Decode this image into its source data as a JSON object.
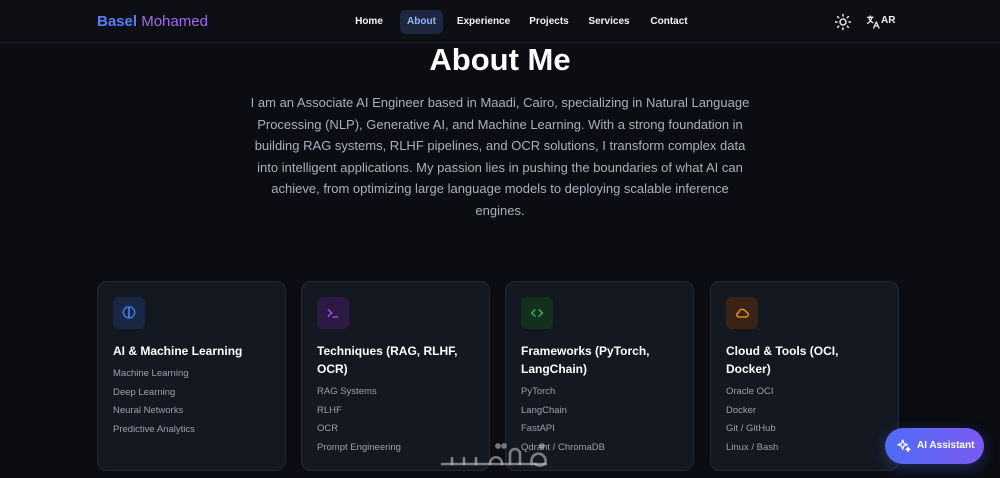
{
  "nav": {
    "brand_first": "Basel",
    "brand_last": "Mohamed",
    "links": [
      "Home",
      "About",
      "Experience",
      "Projects",
      "Services",
      "Contact"
    ],
    "active_link": "About",
    "theme_icon": "sun-icon",
    "lang_icon": "translate-icon",
    "lang_label": "AR"
  },
  "about": {
    "title": "About Me",
    "description": "I am an Associate AI Engineer based in Maadi, Cairo, specializing in Natural Language Processing (NLP), Generative AI, and Machine Learning. With a strong foundation in building RAG systems, RLHF pipelines, and OCR solutions, I transform complex data into intelligent applications. My passion lies in pushing the boundaries of what AI can achieve, from optimizing large language models to deploying scalable inference engines."
  },
  "cards": [
    {
      "icon": "brain-icon",
      "title": "AI & Machine Learning",
      "items": [
        "Machine Learning",
        "Deep Learning",
        "Neural Networks",
        "Predictive Analytics"
      ]
    },
    {
      "icon": "terminal-icon",
      "title": "Techniques (RAG, RLHF, OCR)",
      "items": [
        "RAG Systems",
        "RLHF",
        "OCR",
        "Prompt Engineering"
      ]
    },
    {
      "icon": "code-icon",
      "title": "Frameworks (PyTorch, LangChain)",
      "items": [
        "PyTorch",
        "LangChain",
        "FastAPI",
        "Qdrant / ChromaDB"
      ]
    },
    {
      "icon": "cloud-icon",
      "title": "Cloud & Tools (OCI, Docker)",
      "items": [
        "Oracle OCI",
        "Docker",
        "Git / GitHub",
        "Linux / Bash"
      ]
    }
  ],
  "assistant": {
    "icon": "sparkles-icon",
    "label": "AI Assistant"
  },
  "watermark": {
    "text": "خمسات"
  },
  "colors": {
    "background": "#0b0d12",
    "card": "#141821",
    "accent_blue": "#5b7cfa",
    "accent_purple": "#9b6cf0",
    "brain": "#3b82f6",
    "terminal": "#a855f7",
    "code": "#22c55e",
    "cloud": "#f59e0b"
  }
}
